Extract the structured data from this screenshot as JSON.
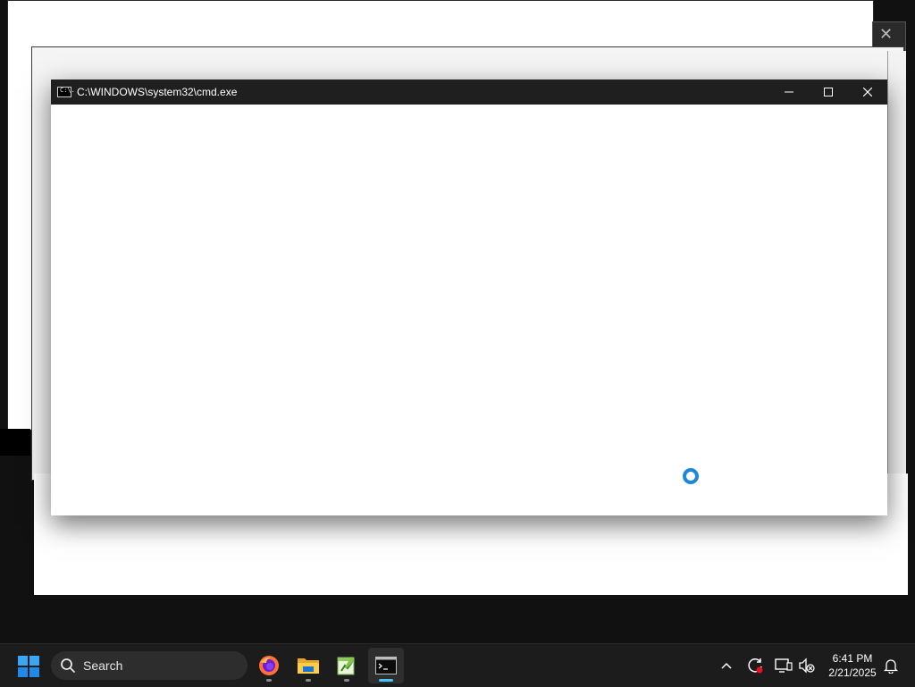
{
  "window": {
    "title": "C:\\WINDOWS\\system32\\cmd.exe",
    "icon": "cmd-icon",
    "icon_text": "C:\\."
  },
  "taskbar": {
    "search_label": "Search",
    "apps": [
      {
        "name": "firefox",
        "icon": "firefox-icon"
      },
      {
        "name": "file-explorer",
        "icon": "folder-icon"
      },
      {
        "name": "notepad-plus-plus",
        "icon": "notepadpp-icon"
      },
      {
        "name": "command-prompt",
        "icon": "terminal-icon",
        "active": true
      }
    ],
    "tray": {
      "chevron": "chevron-up-icon",
      "update": "update-icon",
      "display": "display-icon",
      "volume": "volume-muted-icon"
    },
    "time": "6:41 PM",
    "date": "2/21/2025",
    "notification": "bell-icon"
  },
  "colors": {
    "titlebar": "#1f1f1f",
    "taskbar": "#1c1c1c",
    "accent": "#4cc2ff",
    "spinner": "#1e88d8"
  }
}
